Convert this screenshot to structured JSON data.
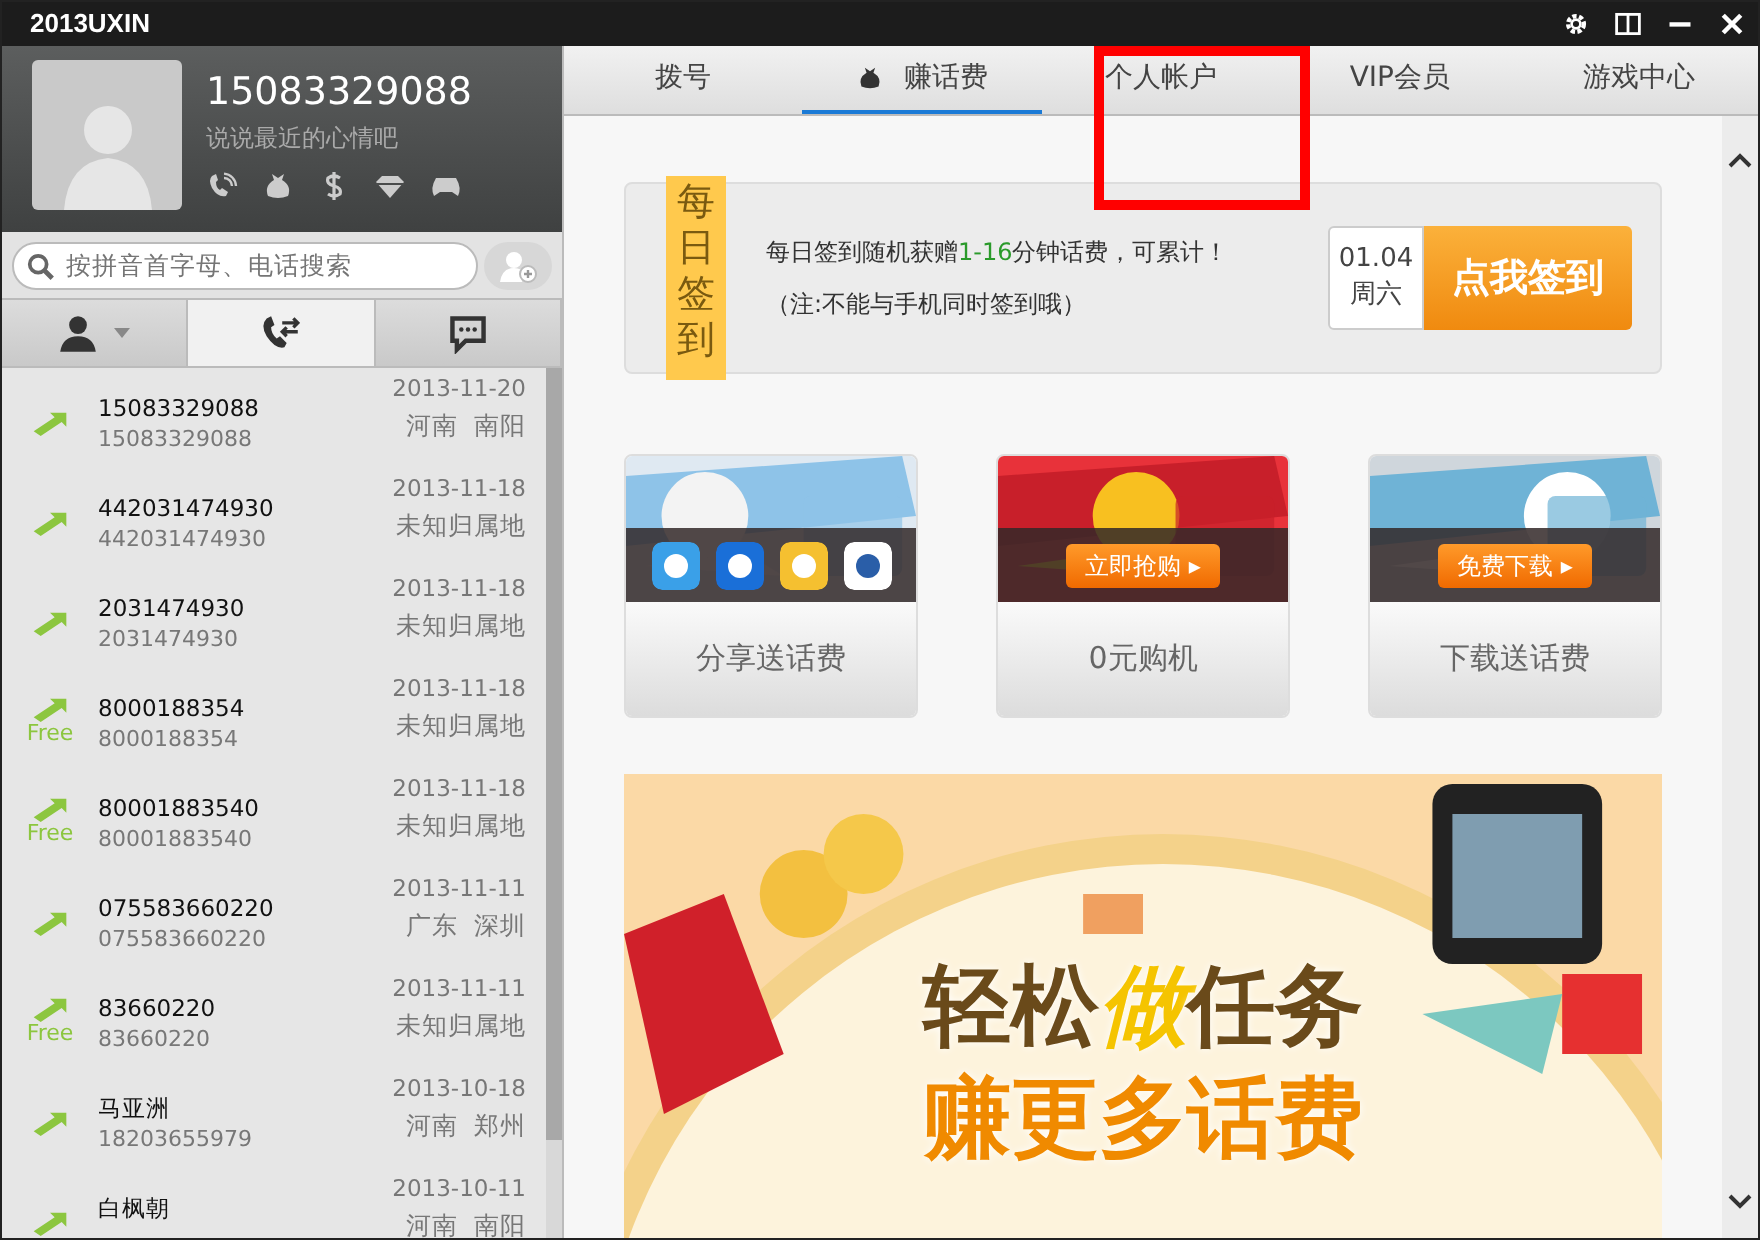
{
  "window": {
    "title": "2013UXIN"
  },
  "profile": {
    "phone": "15083329088",
    "status_placeholder": "说说最近的心情吧"
  },
  "search": {
    "placeholder": "按拼音首字母、电话搜索"
  },
  "left_tabs": [
    {
      "kind": "contacts",
      "selected": false
    },
    {
      "kind": "calls",
      "selected": true
    },
    {
      "kind": "messages",
      "selected": false
    }
  ],
  "call_log": [
    {
      "name": "15083329088",
      "number": "15083329088",
      "date": "2013-11-20",
      "location": "河南  南阳"
    },
    {
      "name": "442031474930",
      "number": "442031474930",
      "date": "2013-11-18",
      "location": "未知归属地"
    },
    {
      "name": "2031474930",
      "number": "2031474930",
      "date": "2013-11-18",
      "location": "未知归属地"
    },
    {
      "name": "8000188354",
      "number": "8000188354",
      "date": "2013-11-18",
      "location": "未知归属地",
      "free_label": "Free"
    },
    {
      "name": "80001883540",
      "number": "80001883540",
      "date": "2013-11-18",
      "location": "未知归属地",
      "free_label": "Free"
    },
    {
      "name": "075583660220",
      "number": "075583660220",
      "date": "2013-11-11",
      "location": "广东  深圳"
    },
    {
      "name": "83660220",
      "number": "83660220",
      "date": "2013-11-11",
      "location": "未知归属地",
      "free_label": "Free"
    },
    {
      "name": "马亚洲",
      "number": "18203655979",
      "date": "2013-10-18",
      "location": "河南  郑州"
    },
    {
      "name": "白枫朝",
      "date": "2013-10-11",
      "location": "河南  南阳"
    }
  ],
  "main_tabs": [
    {
      "label": "拨号",
      "selected": false,
      "highlighted": false
    },
    {
      "label": "赚话费",
      "selected": true,
      "highlighted": false
    },
    {
      "label": "个人帐户",
      "selected": false,
      "highlighted": true
    },
    {
      "label": "VIP会员",
      "selected": false,
      "highlighted": false
    },
    {
      "label": "游戏中心",
      "selected": false,
      "highlighted": false
    }
  ],
  "signin": {
    "badge": "每日签到",
    "text_before": "每日签到随机获赠",
    "text_green": "1-16",
    "text_after": "分钟话费，可累计！",
    "note": "（注:不能与手机同时签到哦）",
    "date": "01.04",
    "weekday": "周六",
    "button": "点我签到"
  },
  "promos": [
    {
      "kind": "apps",
      "label": "分享送话费"
    },
    {
      "kind": "button",
      "label": "0元购机",
      "button": "立即抢购 ▸"
    },
    {
      "kind": "button",
      "label": "下载送话费",
      "button": "免费下载 ▸"
    }
  ],
  "banner": {
    "lines": [
      {
        "before": "轻松",
        "accent": "做",
        "after": "任务"
      },
      {
        "before": "赚更多话费"
      }
    ]
  }
}
